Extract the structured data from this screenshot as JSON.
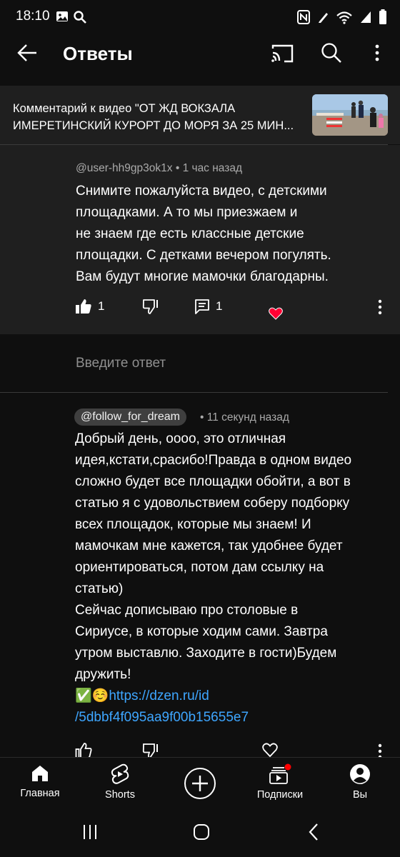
{
  "status": {
    "time": "18:10"
  },
  "appbar": {
    "title": "Ответы"
  },
  "video_ref": {
    "line1": "Комментарий к видео \"ОТ ЖД ВОКЗАЛА",
    "line2": "ИМЕРЕТИНСКИЙ КУРОРТ ДО МОРЯ ЗА 25 МИН..."
  },
  "parent_comment": {
    "author": "@user-hh9gp3ok1x",
    "time": "1 час назад",
    "lines": [
      "Снимите пожалуйста видео, с детскими",
      "площадками. А то мы приезжаем и",
      "не знаем где есть классные детские",
      "площадки. С детками вечером погулять.",
      "Вам будут многие мамочки благодарны."
    ],
    "like_count": "1",
    "reply_count": "1"
  },
  "reply_input": {
    "placeholder": "Введите ответ"
  },
  "reply_comment": {
    "author": "@follow_for_dream",
    "time": "11 секунд назад",
    "lines": [
      "Добрый день,  оооо, это отличная",
      "идея,кстати,срасибо!Правда в одном видео",
      "сложно будет все площадки обойти, а вот  в",
      "статью я с удовольствием соберу  подборку",
      "всех площадок, которые мы знаем! И",
      "мамочкам мне кажется, так удобнее будет",
      "ориентироваться, потом дам ссылку на",
      "статью)",
      "Сейчас  дописываю  про столовые в",
      "Сириусе, в которые ходим сами. Завтра",
      "утром выставлю. Заходите в гости)Будем",
      "дружить!"
    ],
    "emoji": "✅☺️",
    "link_part1": "https://dzen.ru/id",
    "link_part2": "/5dbbf4f095aa9f00b15655e7"
  },
  "bottom_nav": {
    "home": "Главная",
    "shorts": "Shorts",
    "subscriptions": "Подписки",
    "you": "Вы"
  },
  "colors": {
    "background": "#0f0f0f",
    "card": "#1f1f1f",
    "link": "#3ea6ff",
    "heart": "#ff0033",
    "notification": "#ff0000"
  }
}
